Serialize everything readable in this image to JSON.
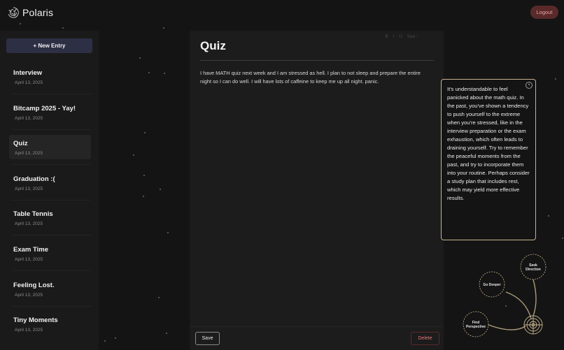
{
  "app": {
    "name": "Polaris",
    "logout_label": "Logout"
  },
  "sidebar": {
    "new_entry_label": "+ New Entry",
    "entries": [
      {
        "title": "Interview",
        "date": "April 13, 2025"
      },
      {
        "title": "Bitcamp 2025 - Yay!",
        "date": "April 13, 2025"
      },
      {
        "title": "Quiz",
        "date": "April 13, 2025"
      },
      {
        "title": "Graduation :(",
        "date": "April 13, 2025"
      },
      {
        "title": "Table Tennis",
        "date": "April 13, 2025"
      },
      {
        "title": "Exam Time",
        "date": "April 13, 2025"
      },
      {
        "title": "Feeling Lost.",
        "date": "April 13, 2025"
      },
      {
        "title": "Tiny Moments",
        "date": "April 13, 2025"
      }
    ],
    "active_entry": "Quiz"
  },
  "editor": {
    "toolbar": {
      "bold": "B",
      "italic": "I",
      "underline": "U",
      "size": "Size ↕"
    },
    "title": "Quiz",
    "body": "I have MATH quiz next week and I am stressed as hell. I plan to not sleep and prepare the entire night so I can do well. I will have lots of caffeine to keep me up all night. panic.",
    "save_label": "Save",
    "delete_label": "Delete"
  },
  "insight": {
    "close_label": "×",
    "text": "It's understandable to feel panicked about the math quiz. In the past, you've shown a tendency to push yourself to the extreme when you're stressed, like in the interview preparation or the exam exhaustion, which often leads to draining yourself. Try to remember the peaceful moments from the past, and try to incorporate them into your routine. Perhaps consider a study plan that includes rest, which may yield more effective results."
  },
  "constellation": {
    "seek_line1": "Seek",
    "seek_line2": "Direction",
    "deeper": "Go Deeper",
    "find_line1": "Find",
    "find_line2": "Perspective",
    "accent_color": "#c8b48c"
  }
}
